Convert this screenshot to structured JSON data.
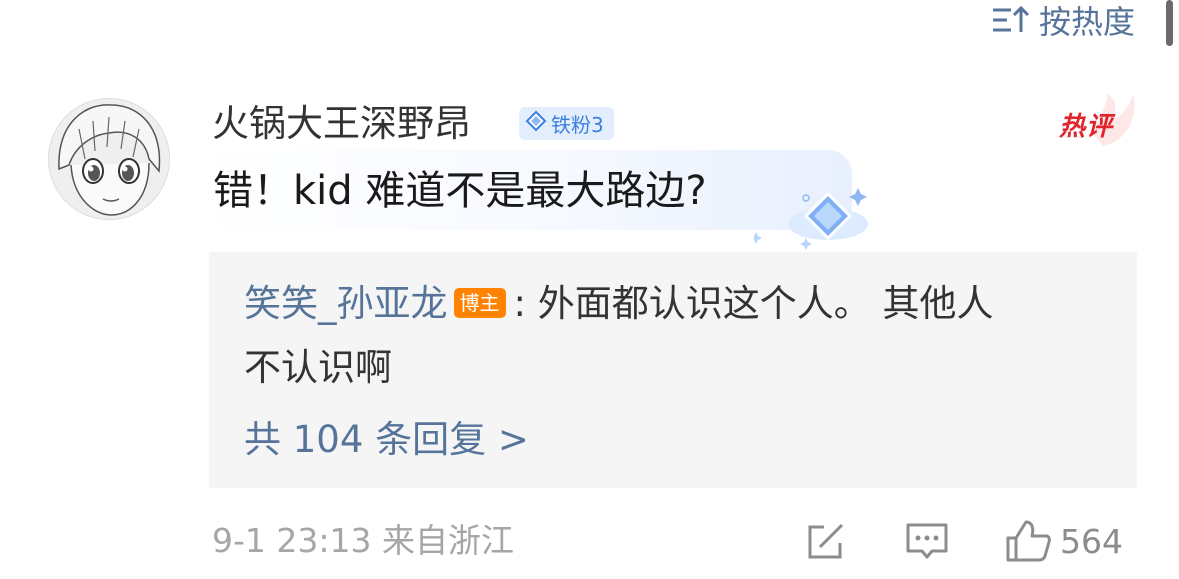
{
  "sort": {
    "label": "按热度",
    "icon": "sort-icon"
  },
  "comment": {
    "username": "火锅大王深野昂",
    "fan_badge": "铁粉3",
    "hot_tag": "热评",
    "text": "错！kid 难道不是最大路边?",
    "avatar_icon": "avatar-image"
  },
  "reply": {
    "author": "笑笑_孙亚龙",
    "author_badge": "博主",
    "text_line1": ": 外面都认识这个人。 其他人",
    "text_line2": "不认识啊",
    "more": "共 104 条回复 >"
  },
  "footer": {
    "time_location": "9-1 23:13  来自浙江",
    "like_count": "564",
    "icons": [
      "share-icon",
      "comment-icon",
      "like-icon"
    ]
  },
  "colors": {
    "link_blue": "#56749a",
    "hot_red": "#e0242b",
    "blogger_orange": "#ff8200",
    "fan_badge_blue": "#3d7fe0",
    "reply_bg": "#f5f5f5",
    "meta_gray": "#a6a6a6"
  }
}
